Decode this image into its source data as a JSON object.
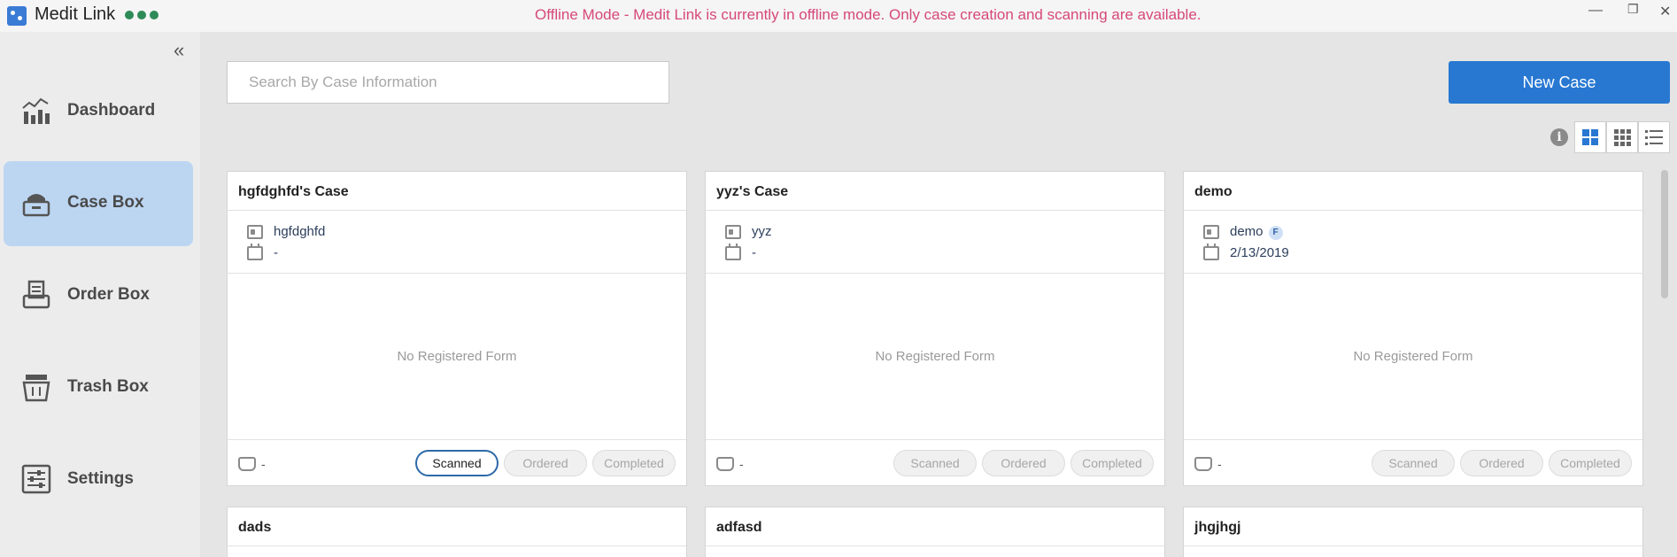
{
  "titlebar": {
    "app_name": "Medit Link",
    "offline_message": "Offline Mode - Medit Link is currently in offline mode. Only case creation and scanning are available.",
    "minimize": "—",
    "restore": "❐",
    "close": "✕"
  },
  "sidebar": {
    "collapse_glyph": "«",
    "items": [
      {
        "label": "Dashboard",
        "icon": "dashboard-icon",
        "active": false
      },
      {
        "label": "Case Box",
        "icon": "case-box-icon",
        "active": true
      },
      {
        "label": "Order Box",
        "icon": "order-box-icon",
        "active": false
      },
      {
        "label": "Trash Box",
        "icon": "trash-box-icon",
        "active": false
      },
      {
        "label": "Settings",
        "icon": "settings-icon",
        "active": false
      }
    ]
  },
  "main": {
    "search_placeholder": "Search By Case Information",
    "new_case_label": "New Case",
    "info_glyph": "i",
    "view_modes": [
      "large-grid",
      "small-grid",
      "list"
    ],
    "active_view": "large-grid",
    "no_form_text": "No Registered Form",
    "status_labels": {
      "scanned": "Scanned",
      "ordered": "Ordered",
      "completed": "Completed"
    },
    "cards": [
      {
        "title": "hgfdghfd's Case",
        "patient": "hgfdghfd",
        "date": "-",
        "scanner_value": "-",
        "scanned_active": true
      },
      {
        "title": "yyz's Case",
        "patient": "yyz",
        "date": "-",
        "scanner_value": "-",
        "scanned_active": false
      },
      {
        "title": "demo",
        "patient": "demo",
        "patient_badge": "F",
        "date": "2/13/2019",
        "scanner_value": "-",
        "scanned_active": false
      },
      {
        "title": "dads"
      },
      {
        "title": "adfasd"
      },
      {
        "title": "jhgjhgj"
      }
    ]
  },
  "colors": {
    "accent": "#2878d2",
    "offline_text": "#d6487a",
    "active_nav_bg": "#bcd6f2",
    "status_dots": "#2e8b57"
  }
}
